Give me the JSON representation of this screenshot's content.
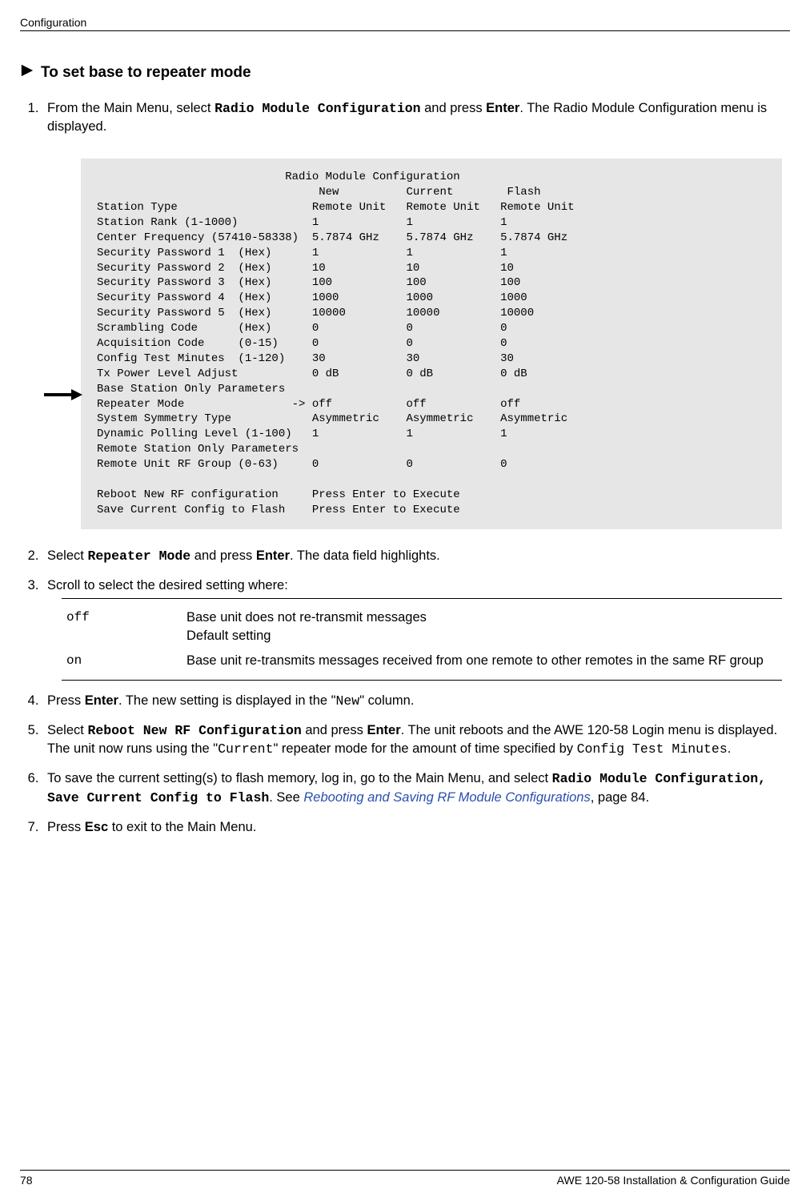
{
  "header": {
    "running": "Configuration"
  },
  "section": {
    "title": "To set base to repeater mode"
  },
  "steps": {
    "s1a": "From the Main Menu, select ",
    "s1b": "Radio Module Configuration",
    "s1c": " and press ",
    "s1d": "Enter",
    "s1e": ". The Radio Module Configuration menu is displayed.",
    "s2a": "Select ",
    "s2b": "Repeater Mode",
    "s2c": " and press ",
    "s2d": "Enter",
    "s2e": ". The data field highlights.",
    "s3": "Scroll to select the desired setting where:",
    "s4a": "Press ",
    "s4b": "Enter",
    "s4c": ". The new setting is displayed in the \"",
    "s4d": "New",
    "s4e": "\" column.",
    "s5a": "Select ",
    "s5b": "Reboot New RF Configuration",
    "s5c": " and press ",
    "s5d": "Enter",
    "s5e": ". The unit reboots and the AWE 120-58 Login menu is displayed. The unit now runs using the \"",
    "s5f": "Current",
    "s5g": "\" repeater mode for the amount of time specified by ",
    "s5h": "Config Test Minutes",
    "s5i": ".",
    "s6a": "To save the current setting(s) to flash memory, log in, go to the Main Menu, and select ",
    "s6b": "Radio Module Configuration, Save Current Config to Flash",
    "s6c": ". See ",
    "s6d": "Rebooting and Saving RF Module Configurations",
    "s6e": ", page 84.",
    "s7a": "Press ",
    "s7b": "Esc",
    "s7c": " to exit to the Main Menu."
  },
  "terminal": {
    "title": "                            Radio Module Configuration",
    "head": "                                 New          Current        Flash",
    "l1": "Station Type                    Remote Unit   Remote Unit   Remote Unit",
    "l2": "Station Rank (1-1000)           1             1             1",
    "l3": "Center Frequency (57410-58338)  5.7874 GHz    5.7874 GHz    5.7874 GHz",
    "l4": "Security Password 1  (Hex)      1             1             1",
    "l5": "Security Password 2  (Hex)      10            10            10",
    "l6": "Security Password 3  (Hex)      100           100           100",
    "l7": "Security Password 4  (Hex)      1000          1000          1000",
    "l8": "Security Password 5  (Hex)      10000         10000         10000",
    "l9": "Scrambling Code      (Hex)      0             0             0",
    "l10": "Acquisition Code     (0-15)     0             0             0",
    "l11": "Config Test Minutes  (1-120)    30            30            30",
    "l12": "Tx Power Level Adjust           0 dB          0 dB          0 dB",
    "l13": "Base Station Only Parameters",
    "l14": "Repeater Mode                -> off           off           off",
    "l15": "System Symmetry Type            Asymmetric    Asymmetric    Asymmetric",
    "l16": "Dynamic Polling Level (1-100)   1             1             1",
    "l17": "Remote Station Only Parameters",
    "l18": "Remote Unit RF Group (0-63)     0             0             0",
    "l19": "",
    "l20": "Reboot New RF configuration     Press Enter to Execute",
    "l21": "Save Current Config to Flash    Press Enter to Execute"
  },
  "settings": {
    "off_key": "off",
    "off_l1": "Base unit does not re-transmit messages",
    "off_l2": "Default setting",
    "on_key": "on",
    "on_val": "Base unit re-transmits messages received from one remote to other remotes in the same RF group"
  },
  "footer": {
    "page": "78",
    "guide": "AWE 120-58 Installation & Configuration Guide"
  }
}
